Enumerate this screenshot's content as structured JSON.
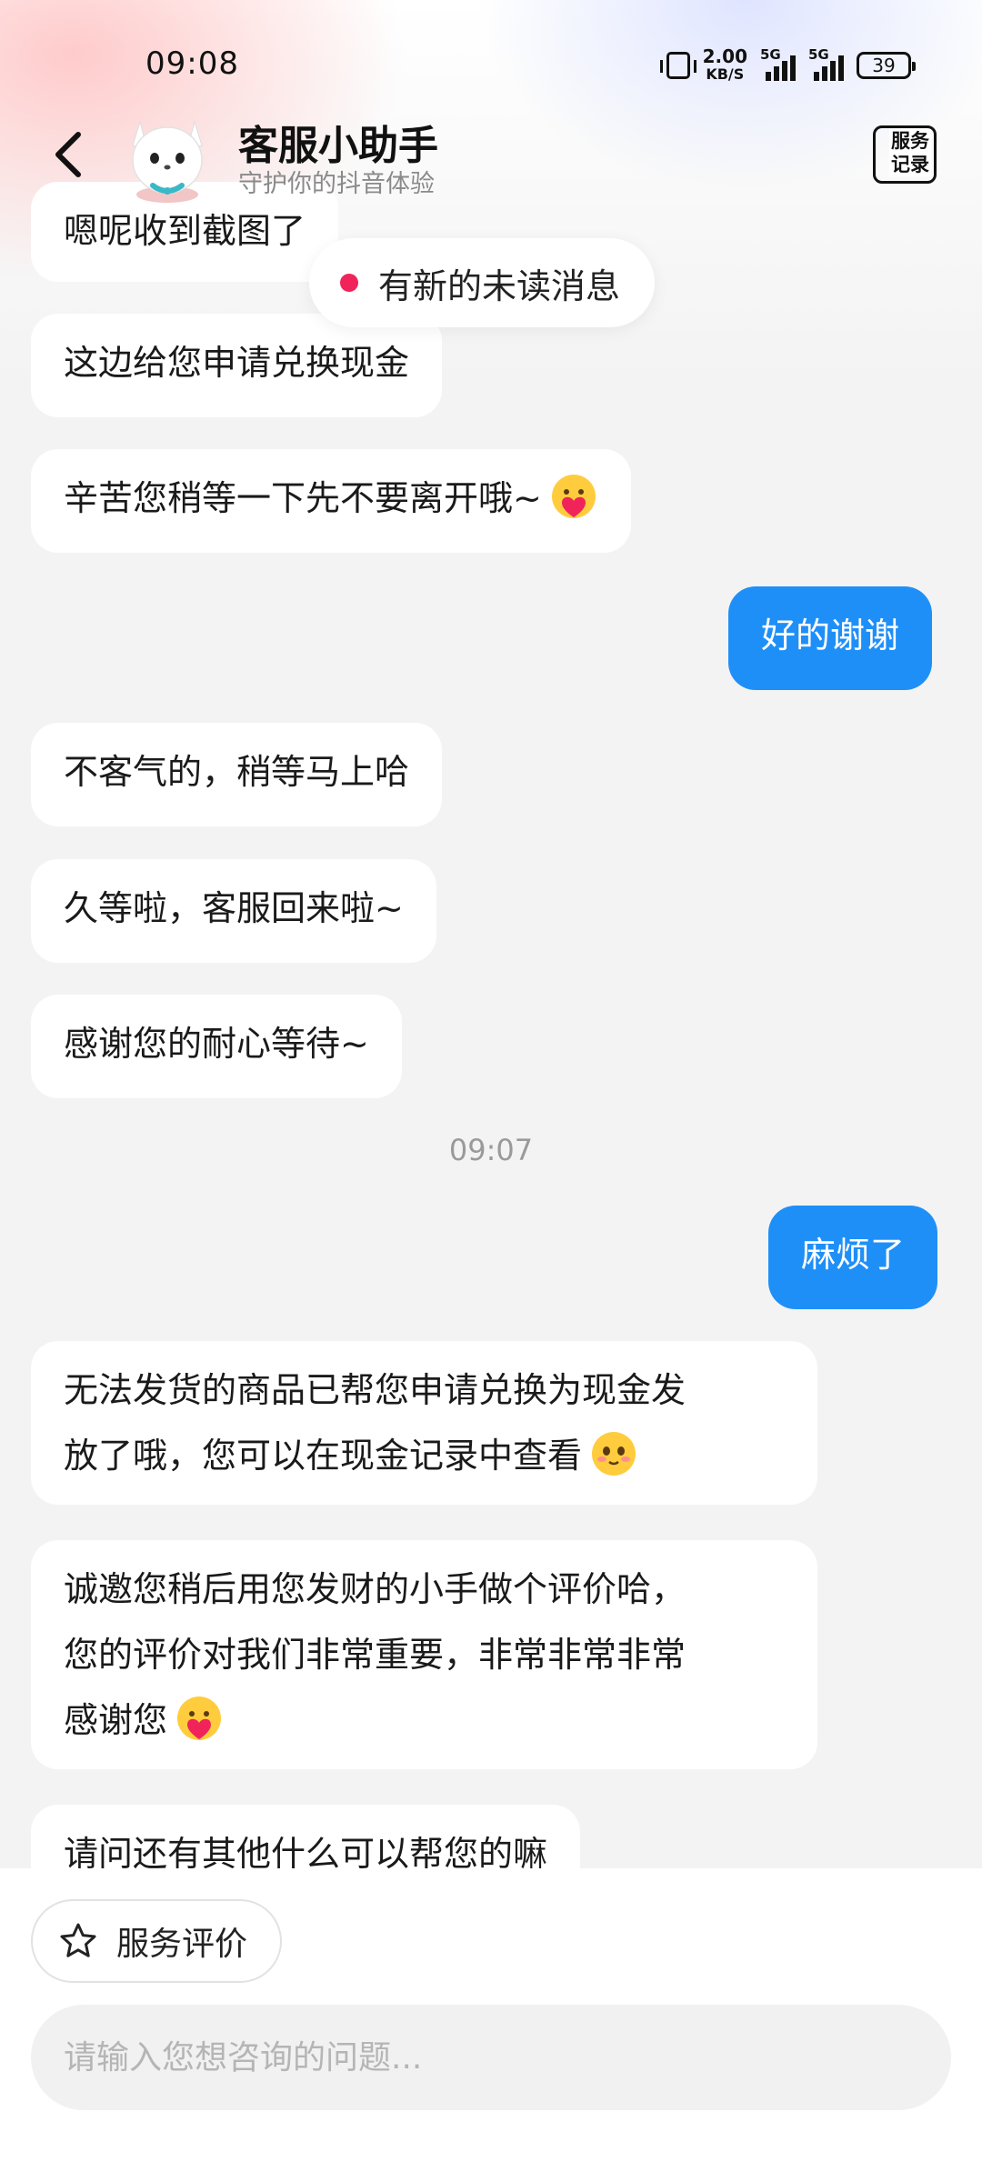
{
  "status_bar": {
    "time": "09:08",
    "speed_value": "2.00",
    "speed_unit": "KB/S",
    "network_1": "5G",
    "network_2": "5G",
    "battery": "39"
  },
  "header": {
    "title": "客服小助手",
    "subtitle": "守护你的抖音体验",
    "service_record_line1": "服务",
    "service_record_line2": "记录"
  },
  "unread_banner": {
    "label": "有新的未读消息"
  },
  "messages": [
    {
      "side": "left",
      "text": "嗯呢收到截图了"
    },
    {
      "side": "left",
      "text": "这边给您申请兑换现金"
    },
    {
      "side": "left",
      "text": "辛苦您稍等一下先不要离开哦~",
      "emoji": "heart-hug-emoji"
    },
    {
      "side": "right",
      "text": "好的谢谢"
    },
    {
      "side": "left",
      "text": "不客气的，稍等马上哈"
    },
    {
      "side": "left",
      "text": "久等啦，客服回来啦~"
    },
    {
      "side": "left",
      "text": "感谢您的耐心等待~"
    },
    {
      "side": "right",
      "text": "麻烦了"
    },
    {
      "side": "left",
      "text_lines": [
        "无法发货的商品已帮您申请兑换为现金发",
        "放了哦，您可以在现金记录中查看"
      ],
      "emoji": "shy-face-emoji"
    },
    {
      "side": "left",
      "text_lines": [
        "诚邀您稍后用您发财的小手做个评价哈，",
        "您的评价对我们非常重要，非常非常非常",
        "感谢您"
      ],
      "emoji": "heart-hug-emoji"
    },
    {
      "side": "left",
      "text": "请问还有其他什么可以帮您的嘛"
    }
  ],
  "timestamp": "09:07",
  "bottom": {
    "rate_button_label": "服务评价",
    "input_placeholder": "请输入您想咨询的问题..."
  },
  "colors": {
    "accent": "#1f8ff8",
    "unread_dot": "#f0245a",
    "background": "#f3f3f3"
  }
}
